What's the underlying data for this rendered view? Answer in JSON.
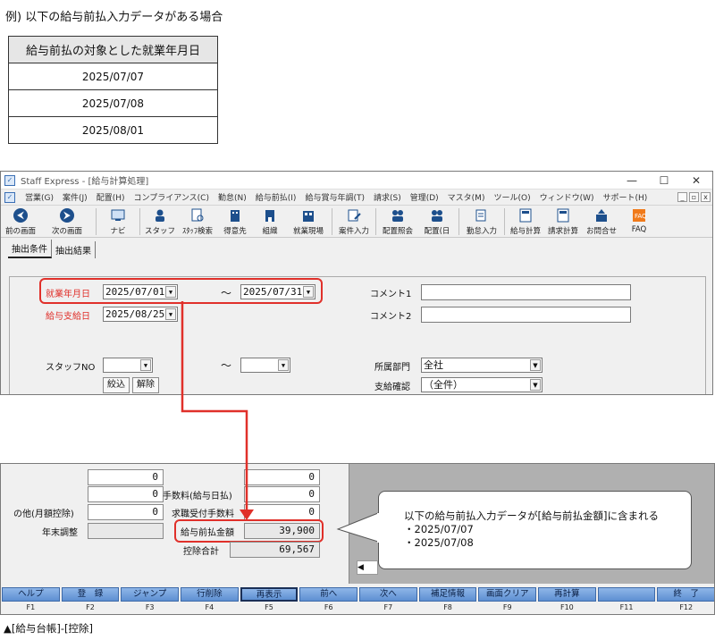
{
  "example_title": "例) 以下の給与前払入力データがある場合",
  "example_table": {
    "header": "給与前払の対象とした就業年月日",
    "rows": [
      "2025/07/07",
      "2025/07/08",
      "2025/08/01"
    ]
  },
  "window1": {
    "title": "Staff Express - [給与計算処理]",
    "controls": [
      "—",
      "☐",
      "✕"
    ],
    "menu": [
      "営業(G)",
      "案件(J)",
      "配置(H)",
      "コンプライアンス(C)",
      "勤怠(N)",
      "給与前払(I)",
      "給与賞与年調(T)",
      "請求(S)",
      "管理(D)",
      "マスタ(M)",
      "ツール(O)",
      "ウィンドウ(W)",
      "サポート(H)"
    ],
    "menu_controls": [
      "_",
      "▫",
      "x"
    ],
    "toolbar": [
      {
        "label": "前の画面",
        "icon": "back-arrow-icon"
      },
      {
        "label": "次の画面",
        "icon": "forward-arrow-icon"
      },
      {
        "label": "ナビ",
        "icon": "navi-icon"
      },
      {
        "label": "スタッフ",
        "icon": "staff-icon"
      },
      {
        "label": "ｽﾀｯﾌ検索",
        "icon": "staff-search-icon"
      },
      {
        "label": "得意先",
        "icon": "client-icon"
      },
      {
        "label": "組織",
        "icon": "organization-icon"
      },
      {
        "label": "就業現場",
        "icon": "worksite-icon"
      },
      {
        "label": "案件入力",
        "icon": "job-entry-icon"
      },
      {
        "label": "配置照会",
        "icon": "placement-inquiry-icon"
      },
      {
        "label": "配置(日",
        "icon": "placement-daily-icon"
      },
      {
        "label": "勤怠入力",
        "icon": "attendance-entry-icon"
      },
      {
        "label": "給与計算",
        "icon": "payroll-calc-icon"
      },
      {
        "label": "請求計算",
        "icon": "billing-calc-icon"
      },
      {
        "label": "お問合せ",
        "icon": "inquiry-icon"
      },
      {
        "label": "FAQ",
        "icon": "faq-icon"
      }
    ],
    "tabs": [
      "抽出条件",
      "抽出結果"
    ],
    "form": {
      "work_date_label": "就業年月日",
      "work_date_from": "2025/07/01",
      "work_date_to": "2025/07/31",
      "range_sep": "～",
      "pay_date_label": "給与支給日",
      "pay_date": "2025/08/25",
      "comment1_label": "コメント1",
      "comment2_label": "コメント2",
      "staff_no_label": "スタッフNO",
      "dept_label": "所属部門",
      "dept_value": "全社",
      "pay_confirm_label": "支給確認",
      "pay_confirm_value": "（全件）",
      "filter_button": "絞込",
      "clear_button": "解除"
    }
  },
  "window2": {
    "fields": [
      {
        "label": "",
        "value": "0",
        "right_label": "",
        "right_value": "0"
      },
      {
        "label": "",
        "value": "0",
        "right_label": "手数料(給与日払)",
        "right_value": "0"
      },
      {
        "label": "の他(月額控除)",
        "value": "0",
        "right_label": "求職受付手数料",
        "right_value": "0"
      },
      {
        "label": "年末調整",
        "value": "",
        "right_label": "給与前払金額",
        "right_value": "39,900"
      },
      {
        "label": "",
        "value": "",
        "right_label": "控除合計",
        "right_value": "69,567"
      }
    ],
    "scroll_arrow": "◀",
    "fkeys": [
      {
        "label": "ヘルプ",
        "key": "F1"
      },
      {
        "label": "登　録",
        "key": "F2"
      },
      {
        "label": "ジャンプ",
        "key": "F3"
      },
      {
        "label": "行削除",
        "key": "F4"
      },
      {
        "label": "再表示",
        "key": "F5"
      },
      {
        "label": "前へ",
        "key": "F6"
      },
      {
        "label": "次へ",
        "key": "F7"
      },
      {
        "label": "補足情報",
        "key": "F8"
      },
      {
        "label": "画面クリア",
        "key": "F9"
      },
      {
        "label": "再計算",
        "key": "F10"
      },
      {
        "label": "",
        "key": "F11"
      },
      {
        "label": "終　了",
        "key": "F12"
      }
    ]
  },
  "callout": {
    "line1": "以下の給与前払入力データが[給与前払金額]に含まれる",
    "line2": "・2025/07/07",
    "line3": "・2025/07/08"
  },
  "caption": "▲[給与台帳]-[控除]",
  "colors": {
    "highlight": "#e0302a",
    "fkey": "#6f9bd8"
  }
}
